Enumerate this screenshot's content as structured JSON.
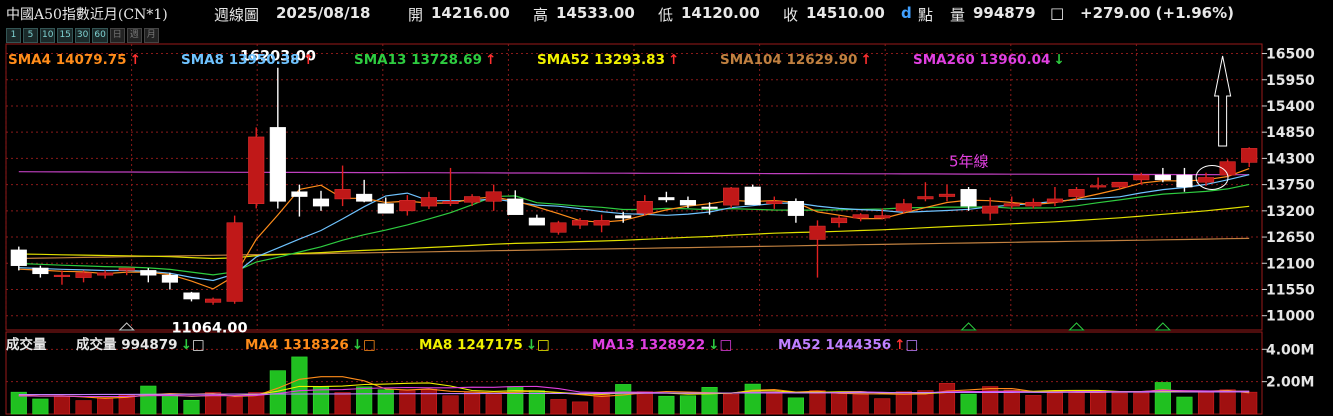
{
  "header": {
    "symbol": "中國A50指數近月(CN*1)",
    "period": "週線圖",
    "date": "2025/08/18",
    "open_label": "開",
    "open": "14216.00",
    "high_label": "高",
    "high": "14533.00",
    "low_label": "低",
    "low": "14120.00",
    "close_label": "收",
    "close": "14510.00",
    "d_label": "d",
    "point_label": "點",
    "volume_label": "量",
    "volume": "994879",
    "volume_box": "□",
    "change": "+279.00 (+1.96%)"
  },
  "toolbar": {
    "buttons": [
      "1",
      "5",
      "10",
      "15",
      "30",
      "60",
      "日",
      "週",
      "月"
    ]
  },
  "price_legend": [
    {
      "label": "SMA4 14079.75",
      "arrow": "↑",
      "color": "#ff8c1a",
      "arrow_color": "#ff3030"
    },
    {
      "label": "SMA8 13950.38",
      "arrow": "↑",
      "color": "#6fc3ff",
      "arrow_color": "#ff3030"
    },
    {
      "label": "SMA13 13728.69",
      "arrow": "↑",
      "color": "#2ecc40",
      "arrow_color": "#ff3030"
    },
    {
      "label": "SMA52 13293.83",
      "arrow": "↑",
      "color": "#f0f000",
      "arrow_color": "#ff3030"
    },
    {
      "label": "SMA104 12629.90",
      "arrow": "↑",
      "color": "#c08040",
      "arrow_color": "#ff3030"
    },
    {
      "label": "SMA260 13960.04",
      "arrow": "↓",
      "color": "#e040e0",
      "arrow_color": "#2ecc40"
    }
  ],
  "volume_legend": [
    {
      "label": "成交量",
      "color": "#e6e6e6",
      "arrow": "",
      "box": ""
    },
    {
      "label": "成交量 994879",
      "color": "#e6e6e6",
      "arrow": "↓",
      "arrow_color": "#2ecc40",
      "box": "□"
    },
    {
      "label": "MA4 1318326",
      "color": "#ff8c1a",
      "arrow": "↓",
      "arrow_color": "#2ecc40",
      "box": "□"
    },
    {
      "label": "MA8 1247175",
      "color": "#f0f000",
      "arrow": "↓",
      "arrow_color": "#2ecc40",
      "box": "□"
    },
    {
      "label": "MA13 1328922",
      "color": "#e040e0",
      "arrow": "↓",
      "arrow_color": "#2ecc40",
      "box": "□"
    },
    {
      "label": "MA52 1444356",
      "color": "#c080ff",
      "arrow": "↑",
      "arrow_color": "#ff3030",
      "box": "□"
    }
  ],
  "annotations": {
    "high_label": "16203.00",
    "low_label": "11064.00",
    "five_year_line_label": "5年線"
  },
  "colors": {
    "up": "#c01818",
    "down": "#ffffff",
    "grid": "#8a1a1a",
    "sma260": "#c040c0",
    "sma104": "#c08040",
    "sma52": "#e0e000",
    "sma13": "#2ecc40",
    "sma8": "#6fc3ff",
    "sma4": "#ff8c1a",
    "vol_up": "#a01010",
    "vol_down": "#20c020"
  },
  "chart_data": {
    "type": "candlestick",
    "price_axis": {
      "ticks": [
        11000,
        11550,
        12100,
        12650,
        13200,
        13750,
        14300,
        14850,
        15400,
        15950,
        16500
      ],
      "ylim": [
        10700,
        16700
      ]
    },
    "volume_axis": {
      "ticks": [
        "2.00M",
        "4.00M"
      ],
      "tick_values": [
        2000000,
        4000000
      ],
      "ylim": [
        0,
        4700000
      ]
    },
    "candles": [
      [
        12380,
        12450,
        11950,
        12050
      ],
      [
        12000,
        12050,
        11800,
        11880
      ],
      [
        11850,
        11950,
        11650,
        11850
      ],
      [
        11800,
        11950,
        11700,
        11900
      ],
      [
        11850,
        11950,
        11780,
        11900
      ],
      [
        11950,
        12000,
        11850,
        12000
      ],
      [
        11950,
        12000,
        11700,
        11850
      ],
      [
        11850,
        11900,
        11550,
        11700
      ],
      [
        11480,
        11500,
        11300,
        11350
      ],
      [
        11280,
        11380,
        11230,
        11350
      ],
      [
        11300,
        13100,
        11250,
        12950
      ],
      [
        13350,
        14950,
        13250,
        14750
      ],
      [
        14950,
        16203,
        13250,
        13400
      ],
      [
        13600,
        13750,
        13080,
        13500
      ],
      [
        13450,
        13620,
        13200,
        13300
      ],
      [
        13450,
        14150,
        13300,
        13650
      ],
      [
        13550,
        13850,
        13380,
        13400
      ],
      [
        13350,
        13480,
        13150,
        13150
      ],
      [
        13200,
        13530,
        13100,
        13420
      ],
      [
        13300,
        13600,
        13240,
        13480
      ],
      [
        13350,
        14100,
        13300,
        13400
      ],
      [
        13380,
        13550,
        13300,
        13500
      ],
      [
        13400,
        13750,
        13200,
        13600
      ],
      [
        13450,
        13630,
        13150,
        13120
      ],
      [
        13050,
        13120,
        12900,
        12900
      ],
      [
        12750,
        12990,
        12700,
        12950
      ],
      [
        12900,
        13050,
        12820,
        13000
      ],
      [
        12900,
        13120,
        12750,
        13000
      ],
      [
        13100,
        13180,
        12950,
        13050
      ],
      [
        13150,
        13530,
        13100,
        13400
      ],
      [
        13480,
        13600,
        13380,
        13430
      ],
      [
        13420,
        13500,
        13260,
        13320
      ],
      [
        13280,
        13380,
        13120,
        13250
      ],
      [
        13320,
        13700,
        13260,
        13680
      ],
      [
        13700,
        13750,
        13330,
        13330
      ],
      [
        13350,
        13500,
        13240,
        13400
      ],
      [
        13400,
        13460,
        12950,
        13100
      ],
      [
        12600,
        13000,
        11800,
        12880
      ],
      [
        12950,
        13100,
        12850,
        13050
      ],
      [
        13050,
        13150,
        12980,
        13120
      ],
      [
        13050,
        13250,
        13020,
        13100
      ],
      [
        13200,
        13450,
        13150,
        13350
      ],
      [
        13450,
        13800,
        13400,
        13500
      ],
      [
        13500,
        13750,
        13400,
        13550
      ],
      [
        13650,
        13700,
        13200,
        13300
      ],
      [
        13150,
        13480,
        13000,
        13300
      ],
      [
        13300,
        13500,
        13250,
        13350
      ],
      [
        13300,
        13460,
        13250,
        13380
      ],
      [
        13380,
        13700,
        13300,
        13450
      ],
      [
        13500,
        13700,
        13420,
        13650
      ],
      [
        13700,
        13900,
        13650,
        13730
      ],
      [
        13700,
        13800,
        13660,
        13800
      ],
      [
        13850,
        14000,
        13750,
        13950
      ],
      [
        13950,
        14100,
        13800,
        13850
      ],
      [
        13950,
        14100,
        13600,
        13700
      ],
      [
        13800,
        14000,
        13720,
        13900
      ],
      [
        13950,
        14280,
        13900,
        14231
      ],
      [
        14216,
        14533,
        14120,
        14510
      ]
    ],
    "volumes": [
      1350000,
      930000,
      1130000,
      830000,
      1000000,
      1180000,
      1730000,
      1130000,
      850000,
      1330000,
      1050000,
      1330000,
      2680000,
      3530000,
      1680000,
      1330000,
      1680000,
      1500000,
      1450000,
      1530000,
      1130000,
      1350000,
      1200000,
      1700000,
      1450000,
      900000,
      750000,
      1250000,
      1830000,
      1380000,
      1100000,
      1130000,
      1650000,
      1230000,
      1850000,
      1330000,
      1000000,
      1450000,
      1350000,
      1200000,
      950000,
      1380000,
      1450000,
      1900000,
      1230000,
      1700000,
      1480000,
      1150000,
      1300000,
      1450000,
      1450000,
      1300000,
      1300000,
      1950000,
      1050000,
      1350000,
      1500000,
      1350000,
      1250000,
      1950000,
      1150000,
      1000000
    ]
  }
}
